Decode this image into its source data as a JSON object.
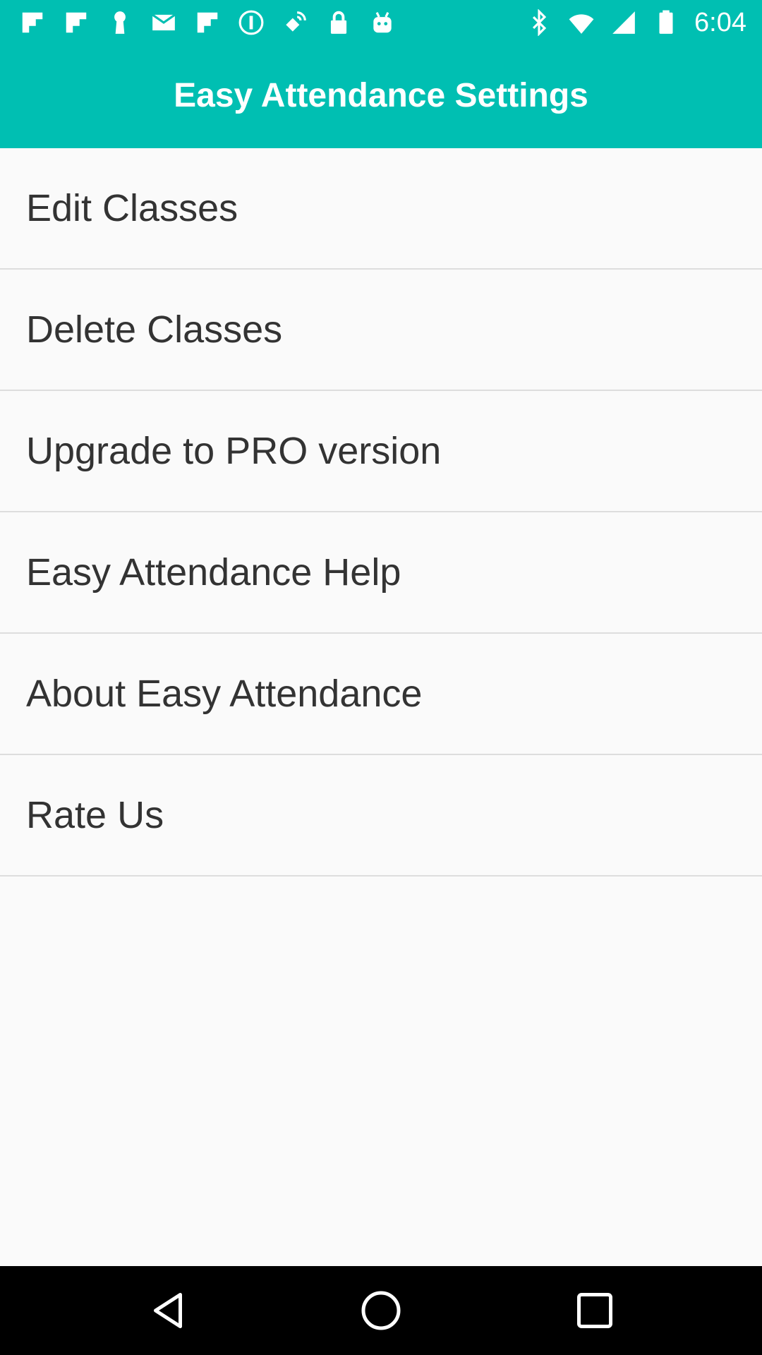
{
  "status_bar": {
    "time": "6:04",
    "left_icons": [
      "flipboard-icon",
      "flipboard-icon",
      "keyhole-icon",
      "email-icon",
      "flipboard-icon",
      "info-circle-icon",
      "fake-gps-icon",
      "lock-icon",
      "android-icon"
    ],
    "right_icons": [
      "bluetooth-icon",
      "wifi-icon",
      "cellular-signal-icon",
      "battery-icon"
    ]
  },
  "app_bar": {
    "title": "Easy Attendance Settings",
    "background_color": "#00bfb2"
  },
  "settings_list": {
    "items": [
      {
        "label": "Edit Classes"
      },
      {
        "label": "Delete Classes"
      },
      {
        "label": "Upgrade to PRO version"
      },
      {
        "label": "Easy Attendance Help"
      },
      {
        "label": "About Easy Attendance"
      },
      {
        "label": "Rate Us"
      }
    ]
  },
  "nav_bar": {
    "buttons": [
      "back-icon",
      "home-icon",
      "recents-icon"
    ]
  }
}
